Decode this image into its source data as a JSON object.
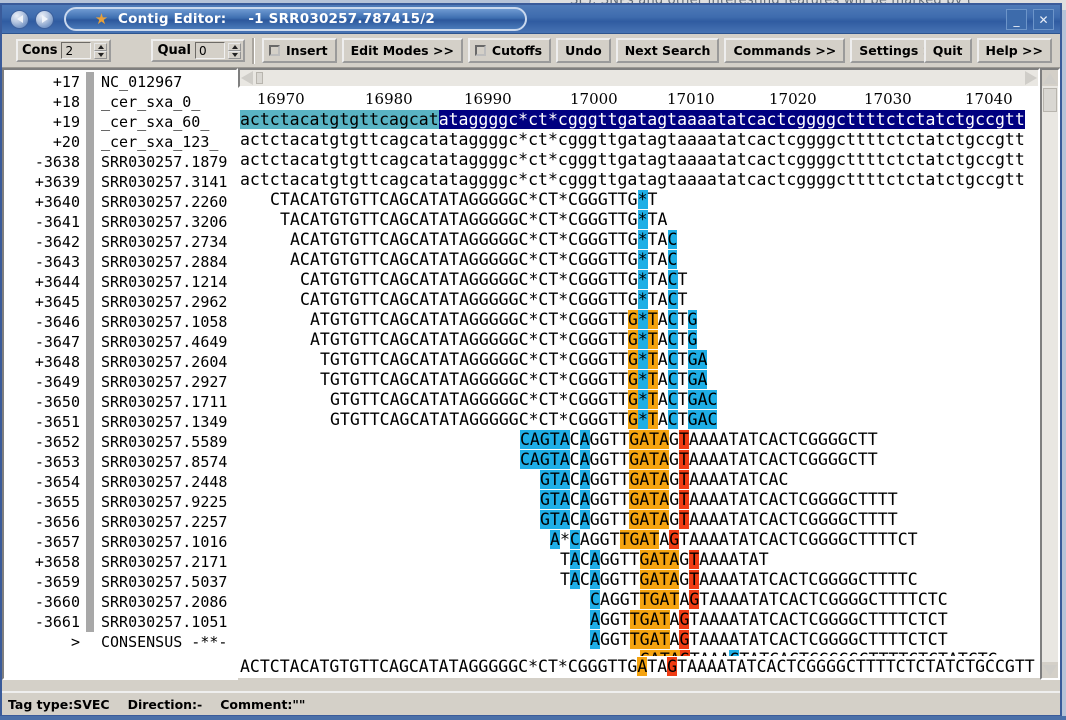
{
  "background_window": {
    "clipped_text": "SE), SNPs and other interesting features will be marked by t"
  },
  "titlebar": {
    "app_icon": "staden-icon",
    "app_name": "Contig Editor:",
    "reading_name": "-1 SRR030257.787415/2",
    "nav_back_icon": "back-arrow-icon",
    "nav_forward_icon": "forward-arrow-icon",
    "minimize_label": "_",
    "close_label": "✕"
  },
  "toolbar": {
    "cons_label": "Cons",
    "cons_value": "2",
    "qual_label": "Qual",
    "qual_value": "0",
    "insert_label": "Insert",
    "edit_modes_label": "Edit Modes  >>",
    "cutoffs_label": "Cutoffs",
    "undo_label": "Undo",
    "next_search_label": "Next Search",
    "commands_label": "Commands  >>",
    "settings_label": "Settings  >>",
    "quit_label": "Quit",
    "help_label": "Help  >>"
  },
  "ruler": {
    "ticks": [
      "16970",
      "16980",
      "16990",
      "17000",
      "17010",
      "17020",
      "17030",
      "17040"
    ],
    "tick_x": [
      255,
      363,
      462,
      568,
      665,
      767,
      862,
      963
    ]
  },
  "reads": [
    {
      "num": "+17",
      "name": "NC_012967",
      "offset": 0,
      "seq": "actctacatgtgttcagcatataggggc*ct*cgggttgatagtaaaatatcactcggggcttttctctatctgccgtt",
      "case": "lower",
      "spans": [
        {
          "s": 0,
          "e": 20,
          "c": "teal"
        },
        {
          "s": 20,
          "e": 80,
          "c": "navy"
        }
      ]
    },
    {
      "num": "+18",
      "name": "_cer_sxa_0_",
      "offset": 0,
      "seq": "actctacatgtgttcagcatataggggc*ct*cgggttgatagtaaaatatcactcggggcttttctctatctgccgtt",
      "case": "lower",
      "spans": []
    },
    {
      "num": "+19",
      "name": "_cer_sxa_60_",
      "offset": 0,
      "seq": "actctacatgtgttcagcatataggggc*ct*cgggttgatagtaaaatatcactcggggcttttctctatctgccgtt",
      "case": "lower",
      "spans": []
    },
    {
      "num": "+20",
      "name": "_cer_sxa_123_",
      "offset": 0,
      "seq": "actctacatgtgttcagcatataggggc*ct*cgggttgatagtaaaatatcactcggggcttttctctatctgccgtt",
      "case": "lower",
      "spans": []
    },
    {
      "num": "-3638",
      "name": "SRR030257.1879",
      "offset": 3,
      "seq": "CTACATGTGTTCAGCATATAGGGGGC*CT*CGGGTTG*T",
      "case": "upper",
      "spans": [
        {
          "s": 37,
          "e": 38,
          "c": "cyan"
        }
      ]
    },
    {
      "num": "+3639",
      "name": "SRR030257.3141",
      "offset": 4,
      "seq": "TACATGTGTTCAGCATATAGGGGGC*CT*CGGGTTG*TA",
      "case": "upper",
      "spans": [
        {
          "s": 36,
          "e": 37,
          "c": "cyan"
        }
      ]
    },
    {
      "num": "+3640",
      "name": "SRR030257.2260",
      "offset": 5,
      "seq": "ACATGTGTTCAGCATATAGGGGGC*CT*CGGGTTG*TAC",
      "case": "upper",
      "spans": [
        {
          "s": 35,
          "e": 36,
          "c": "cyan"
        },
        {
          "s": 38,
          "e": 39,
          "c": "cyan"
        }
      ]
    },
    {
      "num": "-3641",
      "name": "SRR030257.3206",
      "offset": 5,
      "seq": "ACATGTGTTCAGCATATAGGGGGC*CT*CGGGTTG*TAC",
      "case": "upper",
      "spans": [
        {
          "s": 35,
          "e": 36,
          "c": "cyan"
        },
        {
          "s": 38,
          "e": 39,
          "c": "cyan"
        }
      ]
    },
    {
      "num": "-3642",
      "name": "SRR030257.2734",
      "offset": 6,
      "seq": "CATGTGTTCAGCATATAGGGGGC*CT*CGGGTTG*TACT",
      "case": "upper",
      "spans": [
        {
          "s": 34,
          "e": 35,
          "c": "cyan"
        },
        {
          "s": 37,
          "e": 38,
          "c": "cyan"
        }
      ]
    },
    {
      "num": "-3643",
      "name": "SRR030257.2884",
      "offset": 6,
      "seq": "CATGTGTTCAGCATATAGGGGGC*CT*CGGGTTG*TACT",
      "case": "upper",
      "spans": [
        {
          "s": 34,
          "e": 35,
          "c": "cyan"
        },
        {
          "s": 37,
          "e": 38,
          "c": "cyan"
        }
      ]
    },
    {
      "num": "+3644",
      "name": "SRR030257.1214",
      "offset": 7,
      "seq": "ATGTGTTCAGCATATAGGGGGC*CT*CGGGTTG*TACTG",
      "case": "upper",
      "spans": [
        {
          "s": 32,
          "e": 33,
          "c": "orange"
        },
        {
          "s": 33,
          "e": 34,
          "c": "cyan"
        },
        {
          "s": 34,
          "e": 35,
          "c": "orange"
        },
        {
          "s": 36,
          "e": 37,
          "c": "cyan"
        },
        {
          "s": 38,
          "e": 39,
          "c": "cyan"
        }
      ]
    },
    {
      "num": "+3645",
      "name": "SRR030257.2962",
      "offset": 7,
      "seq": "ATGTGTTCAGCATATAGGGGGC*CT*CGGGTTG*TACTG",
      "case": "upper",
      "spans": [
        {
          "s": 32,
          "e": 33,
          "c": "orange"
        },
        {
          "s": 33,
          "e": 34,
          "c": "cyan"
        },
        {
          "s": 34,
          "e": 35,
          "c": "orange"
        },
        {
          "s": 36,
          "e": 37,
          "c": "cyan"
        },
        {
          "s": 38,
          "e": 39,
          "c": "cyan"
        }
      ]
    },
    {
      "num": "-3646",
      "name": "SRR030257.1058",
      "offset": 8,
      "seq": "TGTGTTCAGCATATAGGGGGC*CT*CGGGTTG*TACTGA",
      "case": "upper",
      "spans": [
        {
          "s": 31,
          "e": 32,
          "c": "orange"
        },
        {
          "s": 32,
          "e": 33,
          "c": "cyan"
        },
        {
          "s": 33,
          "e": 34,
          "c": "orange"
        },
        {
          "s": 35,
          "e": 36,
          "c": "cyan"
        },
        {
          "s": 37,
          "e": 39,
          "c": "cyan"
        }
      ]
    },
    {
      "num": "-3647",
      "name": "SRR030257.4649",
      "offset": 8,
      "seq": "TGTGTTCAGCATATAGGGGGC*CT*CGGGTTG*TACTGA",
      "case": "upper",
      "spans": [
        {
          "s": 31,
          "e": 32,
          "c": "orange"
        },
        {
          "s": 32,
          "e": 33,
          "c": "cyan"
        },
        {
          "s": 33,
          "e": 34,
          "c": "orange"
        },
        {
          "s": 35,
          "e": 36,
          "c": "cyan"
        },
        {
          "s": 37,
          "e": 39,
          "c": "cyan"
        }
      ]
    },
    {
      "num": "+3648",
      "name": "SRR030257.2604",
      "offset": 9,
      "seq": "GTGTTCAGCATATAGGGGGC*CT*CGGGTTG*TACTGAC",
      "case": "upper",
      "spans": [
        {
          "s": 30,
          "e": 31,
          "c": "orange"
        },
        {
          "s": 31,
          "e": 32,
          "c": "cyan"
        },
        {
          "s": 32,
          "e": 33,
          "c": "orange"
        },
        {
          "s": 34,
          "e": 35,
          "c": "cyan"
        },
        {
          "s": 36,
          "e": 39,
          "c": "cyan"
        }
      ]
    },
    {
      "num": "-3649",
      "name": "SRR030257.2927",
      "offset": 9,
      "seq": "GTGTTCAGCATATAGGGGGC*CT*CGGGTTG*TACTGAC",
      "case": "upper",
      "spans": [
        {
          "s": 30,
          "e": 31,
          "c": "orange"
        },
        {
          "s": 31,
          "e": 32,
          "c": "cyan"
        },
        {
          "s": 32,
          "e": 33,
          "c": "orange"
        },
        {
          "s": 34,
          "e": 35,
          "c": "cyan"
        },
        {
          "s": 36,
          "e": 39,
          "c": "cyan"
        }
      ]
    },
    {
      "num": "-3650",
      "name": "SRR030257.1711",
      "offset": 28,
      "seq": "CAGTACAGGTTGATAGTAAAATATCACTCGGGGCTT",
      "case": "upper",
      "spans": [
        {
          "s": 0,
          "e": 3,
          "c": "cyan"
        },
        {
          "s": 3,
          "e": 5,
          "c": "cyan"
        },
        {
          "s": 6,
          "e": 7,
          "c": "cyan"
        },
        {
          "s": 11,
          "e": 15,
          "c": "orange"
        },
        {
          "s": 16,
          "e": 17,
          "c": "red"
        }
      ]
    },
    {
      "num": "-3651",
      "name": "SRR030257.1349",
      "offset": 28,
      "seq": "CAGTACAGGTTGATAGTAAAATATCACTCGGGGCTT",
      "case": "upper",
      "spans": [
        {
          "s": 0,
          "e": 3,
          "c": "cyan"
        },
        {
          "s": 3,
          "e": 5,
          "c": "cyan"
        },
        {
          "s": 6,
          "e": 7,
          "c": "cyan"
        },
        {
          "s": 11,
          "e": 15,
          "c": "orange"
        },
        {
          "s": 16,
          "e": 17,
          "c": "red"
        }
      ]
    },
    {
      "num": "-3652",
      "name": "SRR030257.5589",
      "offset": 30,
      "seq": "GTACAGGTTGATAGTAAAATATCAC",
      "case": "upper",
      "spans": [
        {
          "s": 0,
          "e": 3,
          "c": "cyan"
        },
        {
          "s": 4,
          "e": 5,
          "c": "cyan"
        },
        {
          "s": 9,
          "e": 13,
          "c": "orange"
        },
        {
          "s": 14,
          "e": 15,
          "c": "red"
        }
      ]
    },
    {
      "num": "-3653",
      "name": "SRR030257.8574",
      "offset": 30,
      "seq": "GTACAGGTTGATAGTAAAATATCACTCGGGGCTTTT",
      "case": "upper",
      "spans": [
        {
          "s": 0,
          "e": 3,
          "c": "cyan"
        },
        {
          "s": 4,
          "e": 5,
          "c": "cyan"
        },
        {
          "s": 9,
          "e": 13,
          "c": "orange"
        },
        {
          "s": 14,
          "e": 15,
          "c": "red"
        }
      ]
    },
    {
      "num": "-3654",
      "name": "SRR030257.2448",
      "offset": 30,
      "seq": "GTACAGGTTGATAGTAAAATATCACTCGGGGCTTTT",
      "case": "upper",
      "spans": [
        {
          "s": 0,
          "e": 3,
          "c": "cyan"
        },
        {
          "s": 4,
          "e": 5,
          "c": "cyan"
        },
        {
          "s": 9,
          "e": 13,
          "c": "orange"
        },
        {
          "s": 14,
          "e": 15,
          "c": "red"
        }
      ]
    },
    {
      "num": "-3655",
      "name": "SRR030257.9225",
      "offset": 31,
      "seq": "A*CAGGTTGATAGTAAAATATCACTCGGGGCTTTTCT",
      "case": "upper",
      "spans": [
        {
          "s": 0,
          "e": 1,
          "c": "cyan"
        },
        {
          "s": 2,
          "e": 3,
          "c": "cyan"
        },
        {
          "s": 7,
          "e": 11,
          "c": "orange"
        },
        {
          "s": 12,
          "e": 13,
          "c": "red"
        }
      ]
    },
    {
      "num": "-3656",
      "name": "SRR030257.2257",
      "offset": 32,
      "seq": "TACAGGTTGATAGTAAAATAT",
      "case": "upper",
      "spans": [
        {
          "s": 1,
          "e": 2,
          "c": "cyan"
        },
        {
          "s": 3,
          "e": 4,
          "c": "cyan"
        },
        {
          "s": 8,
          "e": 12,
          "c": "orange"
        },
        {
          "s": 13,
          "e": 14,
          "c": "red"
        }
      ]
    },
    {
      "num": "-3657",
      "name": "SRR030257.1016",
      "offset": 32,
      "seq": "TACAGGTTGATAGTAAAATATCACTCGGGGCTTTTC",
      "case": "upper",
      "spans": [
        {
          "s": 1,
          "e": 2,
          "c": "cyan"
        },
        {
          "s": 3,
          "e": 4,
          "c": "cyan"
        },
        {
          "s": 8,
          "e": 12,
          "c": "orange"
        },
        {
          "s": 13,
          "e": 14,
          "c": "red"
        }
      ]
    },
    {
      "num": "+3658",
      "name": "SRR030257.2171",
      "offset": 35,
      "seq": "CAGGTTGATAGTAAAATATCACTCGGGGCTTTTCTC",
      "case": "upper",
      "spans": [
        {
          "s": 0,
          "e": 1,
          "c": "cyan"
        },
        {
          "s": 5,
          "e": 9,
          "c": "orange"
        },
        {
          "s": 10,
          "e": 11,
          "c": "red"
        }
      ]
    },
    {
      "num": "-3659",
      "name": "SRR030257.5037",
      "offset": 35,
      "seq": "AGGTTGATAGTAAAATATCACTCGGGGCTTTTCTCT",
      "case": "upper",
      "spans": [
        {
          "s": 0,
          "e": 1,
          "c": "cyan"
        },
        {
          "s": 4,
          "e": 8,
          "c": "orange"
        },
        {
          "s": 9,
          "e": 10,
          "c": "red"
        }
      ]
    },
    {
      "num": "-3660",
      "name": "SRR030257.2086",
      "offset": 35,
      "seq": "AGGTTGATAGTAAAATATCACTCGGGGCTTTTCTCT",
      "case": "upper",
      "spans": [
        {
          "s": 0,
          "e": 1,
          "c": "cyan"
        },
        {
          "s": 4,
          "e": 8,
          "c": "orange"
        },
        {
          "s": 9,
          "e": 10,
          "c": "red"
        }
      ]
    },
    {
      "num": "-3661",
      "name": "SRR030257.1051",
      "offset": 40,
      "seq": "GATAGTAAAGTATCACTCGGGGCTTTTCTCTATCTG",
      "case": "upper",
      "spans": [
        {
          "s": 0,
          "e": 4,
          "c": "orange"
        },
        {
          "s": 4,
          "e": 5,
          "c": "red"
        },
        {
          "s": 9,
          "e": 10,
          "c": "cyan"
        }
      ]
    }
  ],
  "consensus": {
    "num": ">",
    "name": "CONSENSUS  -**-",
    "offset": 0,
    "seq": "ACTCTACATGTGTTCAGCATATAGGGGGC*CT*CGGGTTGATAGTAAAATATCACTCGGGGCTTTTCTCTATCTGCCGTT",
    "spans": [
      {
        "s": 40,
        "e": 41,
        "c": "orange"
      },
      {
        "s": 43,
        "e": 44,
        "c": "red"
      }
    ]
  },
  "statusbar": {
    "tag_type": "Tag type:SVEC",
    "direction": "Direction:-",
    "comment": "Comment:\"\""
  },
  "colors": {
    "teal": "#5ab4c4",
    "navy": "#000080",
    "cyan": "#1eaee6",
    "orange": "#f5a30f",
    "red": "#f03c13",
    "titlebar": "#3f6cae",
    "chrome": "#d4d0c8"
  }
}
